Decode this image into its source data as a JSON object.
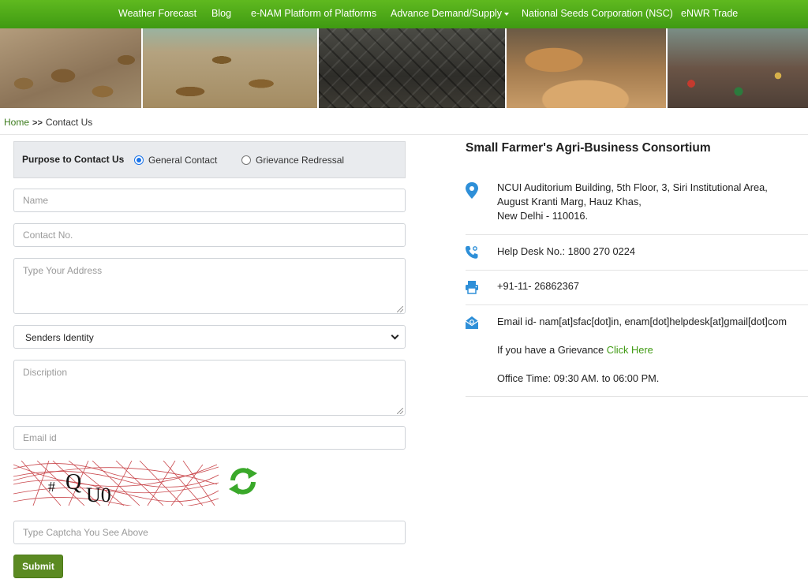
{
  "nav": {
    "items": [
      "Weather Forecast",
      "Blog",
      "e-NAM Platform of Platforms",
      "Advance Demand/Supply",
      "National Seeds Corporation (NSC)",
      "eNWR Trade"
    ]
  },
  "breadcrumb": {
    "home": "Home",
    "separator": ">>",
    "current": "Contact Us"
  },
  "form": {
    "purpose_label": "Purpose to Contact Us",
    "purpose_options": [
      "General Contact",
      "Grievance Redressal"
    ],
    "purpose_selected": "General Contact",
    "name_placeholder": "Name",
    "contact_placeholder": "Contact No.",
    "address_placeholder": "Type Your Address",
    "identity_selected": "Senders Identity",
    "description_placeholder": "Discription",
    "email_placeholder": "Email id",
    "captcha_text": "# Q U0",
    "captcha_placeholder": "Type Captcha You See Above",
    "submit_label": "Submit"
  },
  "contact": {
    "org_name": "Small Farmer's Agri-Business Consortium",
    "address_line1": "NCUI Auditorium Building, 5th Floor, 3, Siri Institutional Area,",
    "address_line2": "August Kranti Marg, Hauz Khas,",
    "address_line3": "New Delhi - 110016.",
    "helpdesk": "Help Desk No.: 1800 270 0224",
    "fax": "+91-11- 26862367",
    "email": "Email id- nam[at]sfac[dot]in, enam[dot]helpdesk[at]gmail[dot]com",
    "grievance_text": "If you have a Grievance",
    "grievance_link": "Click Here",
    "office_time": "Office Time: 09:30 AM. to 06:00 PM."
  },
  "colors": {
    "nav_green": "#4aa815",
    "submit_green": "#5b8a22",
    "link_green": "#3f9a12",
    "icon_blue": "#2e8fd8"
  },
  "icons": [
    "caret-down-icon",
    "map-pin-icon",
    "phone-icon",
    "printer-icon",
    "email-icon",
    "refresh-icon",
    "chevron-down-icon"
  ]
}
